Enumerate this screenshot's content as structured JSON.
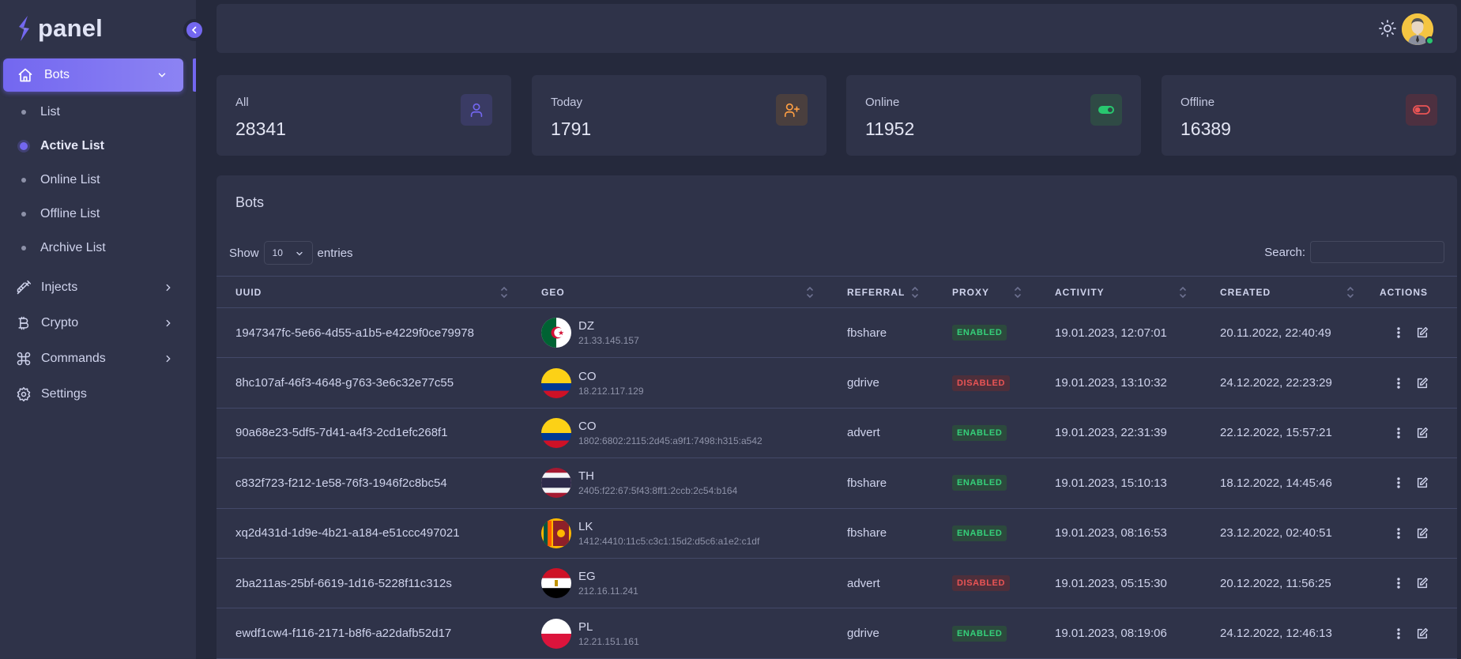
{
  "brand": {
    "name": "panel"
  },
  "sidebar": {
    "active_menu": {
      "label": "Bots",
      "icon": "home-icon"
    },
    "sub_items": [
      {
        "label": "List",
        "active": false
      },
      {
        "label": "Active List",
        "active": true
      },
      {
        "label": "Online List",
        "active": false
      },
      {
        "label": "Offline List",
        "active": false
      },
      {
        "label": "Archive List",
        "active": false
      }
    ],
    "items": [
      {
        "label": "Injects",
        "icon": "syringe-icon",
        "has_submenu": true
      },
      {
        "label": "Crypto",
        "icon": "bitcoin-icon",
        "has_submenu": true
      },
      {
        "label": "Commands",
        "icon": "command-icon",
        "has_submenu": true
      },
      {
        "label": "Settings",
        "icon": "gear-icon",
        "has_submenu": false
      }
    ]
  },
  "stats": [
    {
      "title": "All",
      "value": "28341",
      "icon": "user-icon",
      "color": "#7367f0"
    },
    {
      "title": "Today",
      "value": "1791",
      "icon": "user-plus-icon",
      "color": "#ff9f43"
    },
    {
      "title": "Online",
      "value": "11952",
      "icon": "toggle-on-icon",
      "color": "#28c76f"
    },
    {
      "title": "Offline",
      "value": "16389",
      "icon": "toggle-off-icon",
      "color": "#ea5455"
    }
  ],
  "table": {
    "title": "Bots",
    "show_label": "Show",
    "entries_value": "10",
    "entries_label": "entries",
    "search_label": "Search:",
    "search_value": "",
    "columns": [
      "UUID",
      "GEO",
      "REFERRAL",
      "PROXY",
      "ACTIVITY",
      "CREATED",
      "ACTIONS"
    ],
    "rows": [
      {
        "uuid": "1947347fc-5e66-4d55-a1b5-e4229f0ce79978",
        "country": "DZ",
        "ip": "21.33.145.157",
        "referral": "fbshare",
        "proxy": "ENABLED",
        "activity": "19.01.2023, 12:07:01",
        "created": "20.11.2022, 22:40:49"
      },
      {
        "uuid": "8hc107af-46f3-4648-g763-3e6c32e77c55",
        "country": "CO",
        "ip": "18.212.117.129",
        "referral": "gdrive",
        "proxy": "DISABLED",
        "activity": "19.01.2023, 13:10:32",
        "created": "24.12.2022, 22:23:29"
      },
      {
        "uuid": "90a68e23-5df5-7d41-a4f3-2cd1efc268f1",
        "country": "CO",
        "ip": "1802:6802:2115:2d45:a9f1:7498:h315:a542",
        "referral": "advert",
        "proxy": "ENABLED",
        "activity": "19.01.2023, 22:31:39",
        "created": "22.12.2022, 15:57:21"
      },
      {
        "uuid": "c832f723-f212-1e58-76f3-1946f2c8bc54",
        "country": "TH",
        "ip": "2405:f22:67:5f43:8ff1:2ccb:2c54:b164",
        "referral": "fbshare",
        "proxy": "ENABLED",
        "activity": "19.01.2023, 15:10:13",
        "created": "18.12.2022, 14:45:46"
      },
      {
        "uuid": "xq2d431d-1d9e-4b21-a184-e51ccc497021",
        "country": "LK",
        "ip": "1412:4410:11c5:c3c1:15d2:d5c6:a1e2:c1df",
        "referral": "fbshare",
        "proxy": "ENABLED",
        "activity": "19.01.2023, 08:16:53",
        "created": "23.12.2022, 02:40:51"
      },
      {
        "uuid": "2ba211as-25bf-6619-1d16-5228f11c312s",
        "country": "EG",
        "ip": "212.16.11.241",
        "referral": "advert",
        "proxy": "DISABLED",
        "activity": "19.01.2023, 05:15:30",
        "created": "20.12.2022, 11:56:25"
      },
      {
        "uuid": "ewdf1cw4-f116-2171-b8f6-a22dafb52d17",
        "country": "PL",
        "ip": "12.21.151.161",
        "referral": "gdrive",
        "proxy": "ENABLED",
        "activity": "19.01.2023, 08:19:06",
        "created": "24.12.2022, 12:46:13"
      }
    ]
  },
  "colors": {
    "primary": "#7367f0",
    "success": "#28c76f",
    "danger": "#ea5455",
    "warning": "#ff9f43"
  }
}
